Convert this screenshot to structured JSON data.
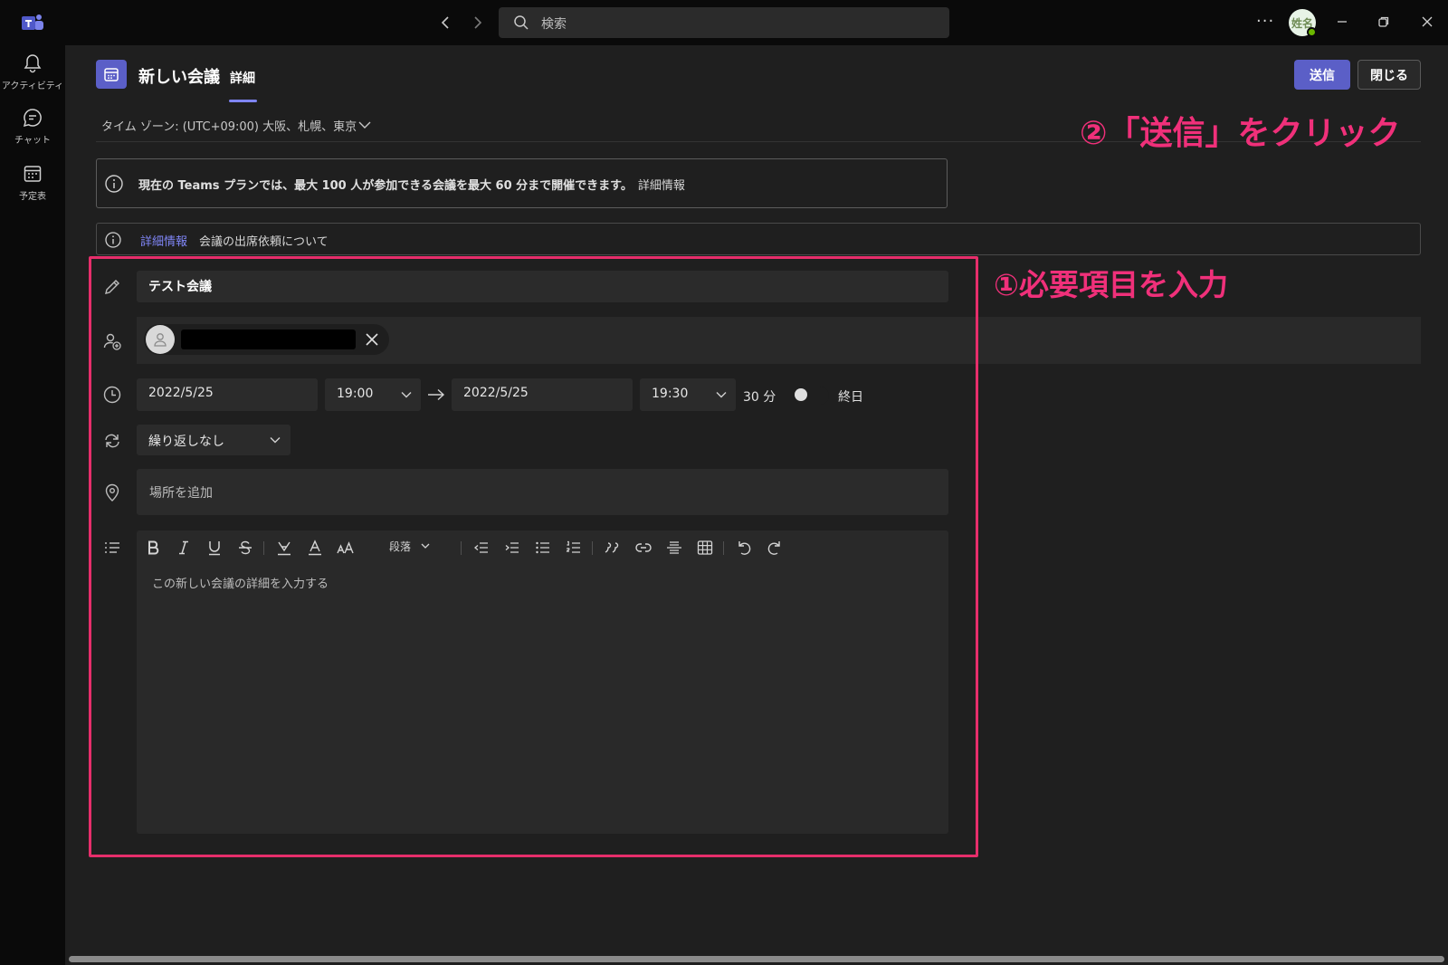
{
  "titlebar": {
    "search_placeholder": "検索",
    "more": "···",
    "avatar_text": "姓名"
  },
  "rail": {
    "activity": "アクティビティ",
    "chat": "チャット",
    "calendar": "予定表"
  },
  "header": {
    "title": "新しい会議",
    "tab_details": "詳細",
    "send": "送信",
    "close": "閉じる",
    "timezone": "タイム ゾーン: (UTC+09:00) 大阪、札幌、東京"
  },
  "banners": {
    "plan_notice": "現在の Teams プランでは、最大 100 人が参加できる会議を最大 60 分まで開催できます。",
    "plan_link": "詳細情報",
    "attendance_link": "詳細情報",
    "attendance_text": "会議の出席依頼について"
  },
  "form": {
    "title_value": "テスト会議",
    "start_date": "2022/5/25",
    "start_time": "19:00",
    "end_date": "2022/5/25",
    "end_time": "19:30",
    "duration": "30 分",
    "all_day_label": "終日",
    "all_day_on": false,
    "repeat": "繰り返しなし",
    "location_placeholder": "場所を追加",
    "paragraph_style": "段落",
    "details_placeholder": "この新しい会議の詳細を入力する"
  },
  "annotations": {
    "step1": "①必要項目を入力",
    "step2": "②「送信」をクリック"
  },
  "colors": {
    "accent": "#5b5fc7",
    "annotation": "#f0307a",
    "background": "#1f1f1f"
  }
}
